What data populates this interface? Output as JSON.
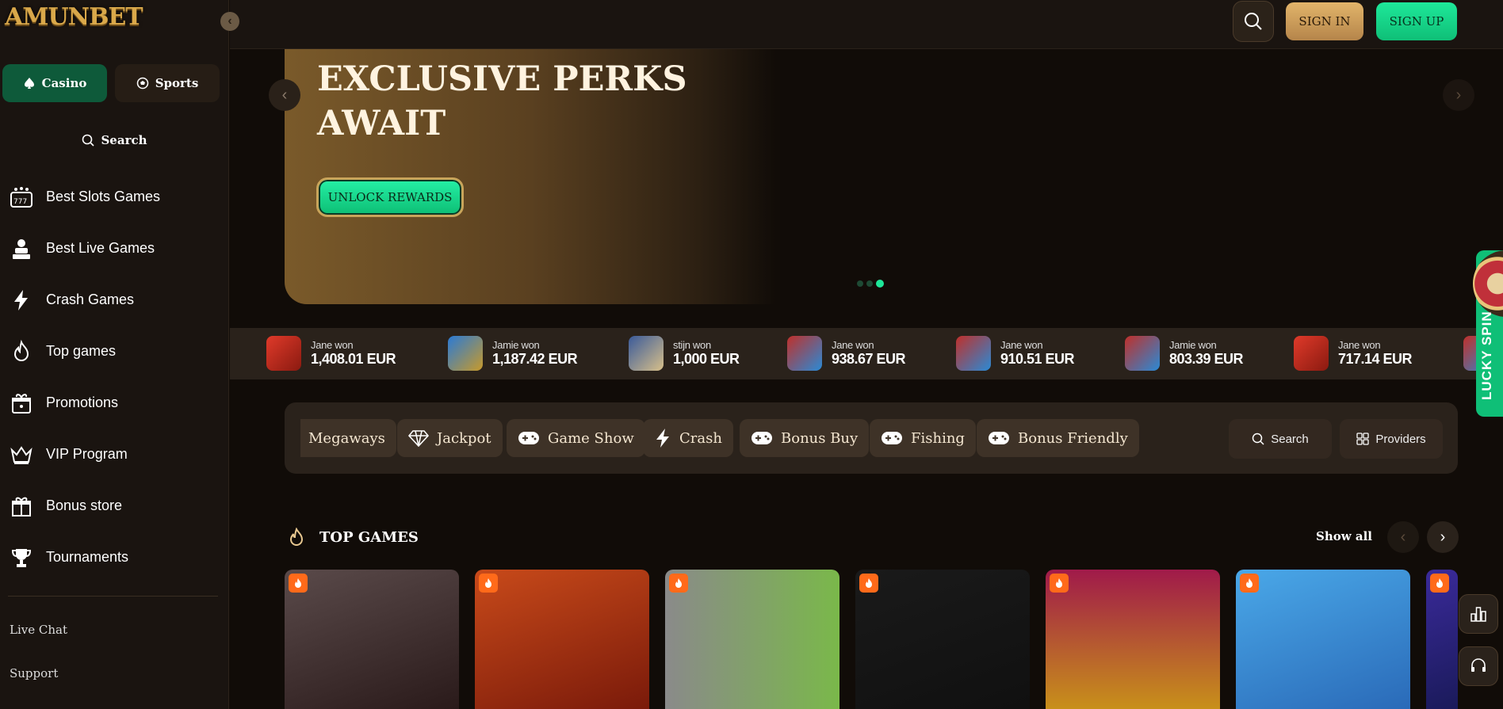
{
  "brand": {
    "logo_text": "AMUNBET"
  },
  "sidebar": {
    "tabs": [
      {
        "label": "Casino"
      },
      {
        "label": "Sports"
      }
    ],
    "search_label": "Search",
    "items": [
      {
        "label": "Best Slots Games",
        "icon": "slot-machine-icon"
      },
      {
        "label": "Best Live Games",
        "icon": "live-dealer-icon"
      },
      {
        "label": "Crash Games",
        "icon": "lightning-icon"
      },
      {
        "label": "Top games",
        "icon": "flame-icon"
      },
      {
        "label": "Promotions",
        "icon": "gift-icon"
      },
      {
        "label": "VIP Program",
        "icon": "crown-icon"
      },
      {
        "label": "Bonus store",
        "icon": "gift-box-icon"
      },
      {
        "label": "Tournaments",
        "icon": "trophy-icon"
      }
    ],
    "footer_links": [
      {
        "label": "Live Chat"
      },
      {
        "label": "Support"
      }
    ]
  },
  "header": {
    "signin_label": "SIGN IN",
    "signup_label": "SIGN UP"
  },
  "hero": {
    "title_line1": "EXCLUSIVE PERKS",
    "title_line2": "AWAIT",
    "cta_label": "UNLOCK REWARDS",
    "slides_count": 3,
    "active_slide": 3
  },
  "recent_wins": [
    {
      "name": "Jane won",
      "amount": "1,408.01 EUR",
      "thumb_color": "#c0302a"
    },
    {
      "name": "Jamie won",
      "amount": "1,187.42 EUR",
      "thumb_color": "#1b5fae"
    },
    {
      "name": "stijn won",
      "amount": "1,000 EUR",
      "thumb_color": "#3a5a9a"
    },
    {
      "name": "Jane won",
      "amount": "938.67 EUR",
      "thumb_color": "#2a8ad6"
    },
    {
      "name": "Jane won",
      "amount": "910.51 EUR",
      "thumb_color": "#2a8ad6"
    },
    {
      "name": "Jamie won",
      "amount": "803.39 EUR",
      "thumb_color": "#2a8ad6"
    },
    {
      "name": "Jane won",
      "amount": "717.14 EUR",
      "thumb_color": "#c0302a"
    }
  ],
  "lucky_spin": {
    "label": "LUCKY SPIN"
  },
  "categories": [
    {
      "label": "Megaways",
      "icon": "megaways-icon"
    },
    {
      "label": "Jackpot",
      "icon": "diamond-icon"
    },
    {
      "label": "Game Show",
      "icon": "gamepad-icon"
    },
    {
      "label": "Crash",
      "icon": "lightning-icon"
    },
    {
      "label": "Bonus Buy",
      "icon": "gamepad-icon"
    },
    {
      "label": "Fishing",
      "icon": "gamepad-icon"
    },
    {
      "label": "Bonus Friendly",
      "icon": "gamepad-icon"
    }
  ],
  "filters": {
    "search_label": "Search",
    "providers_label": "Providers"
  },
  "top_games": {
    "title": "TOP GAMES",
    "show_all_label": "Show all",
    "cards": [
      {
        "name": "game-card-1",
        "bg": "#3a2a2a"
      },
      {
        "name": "game-card-2",
        "bg": "#a8381a"
      },
      {
        "name": "game-card-3",
        "bg": "#7aa84a"
      },
      {
        "name": "game-card-4",
        "bg": "#141414"
      },
      {
        "name": "game-card-5",
        "bg": "#a01a3a"
      },
      {
        "name": "game-card-6",
        "bg": "#3a9ad8"
      },
      {
        "name": "game-card-7",
        "bg": "#3a2a7a"
      }
    ]
  },
  "colors": {
    "accent_green": "#1ee89a",
    "gold": "#d9a84a",
    "background": "#110c08"
  }
}
